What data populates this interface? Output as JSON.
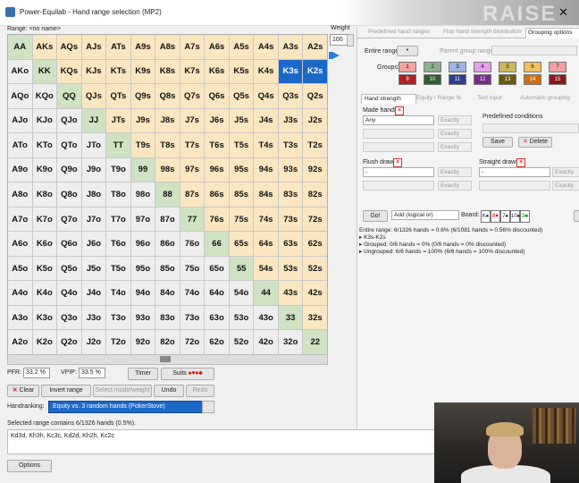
{
  "window": {
    "title": "Power-Equilab - Hand range selection (MP2)",
    "brand_bg": "RAISE"
  },
  "range": {
    "label": "Range: <no name>"
  },
  "weight": {
    "label": "Weight",
    "value": "100"
  },
  "grid": [
    [
      "AA",
      "AKs",
      "AQs",
      "AJs",
      "ATs",
      "A9s",
      "A8s",
      "A7s",
      "A6s",
      "A5s",
      "A4s",
      "A3s",
      "A2s"
    ],
    [
      "AKo",
      "KK",
      "KQs",
      "KJs",
      "KTs",
      "K9s",
      "K8s",
      "K7s",
      "K6s",
      "K5s",
      "K4s",
      "K3s",
      "K2s"
    ],
    [
      "AQo",
      "KQo",
      "QQ",
      "QJs",
      "QTs",
      "Q9s",
      "Q8s",
      "Q7s",
      "Q6s",
      "Q5s",
      "Q4s",
      "Q3s",
      "Q2s"
    ],
    [
      "AJo",
      "KJo",
      "QJo",
      "JJ",
      "JTs",
      "J9s",
      "J8s",
      "J7s",
      "J6s",
      "J5s",
      "J4s",
      "J3s",
      "J2s"
    ],
    [
      "ATo",
      "KTo",
      "QTo",
      "JTo",
      "TT",
      "T9s",
      "T8s",
      "T7s",
      "T6s",
      "T5s",
      "T4s",
      "T3s",
      "T2s"
    ],
    [
      "A9o",
      "K9o",
      "Q9o",
      "J9o",
      "T9o",
      "99",
      "98s",
      "97s",
      "96s",
      "95s",
      "94s",
      "93s",
      "92s"
    ],
    [
      "A8o",
      "K8o",
      "Q8o",
      "J8o",
      "T8o",
      "98o",
      "88",
      "87s",
      "86s",
      "85s",
      "84s",
      "83s",
      "82s"
    ],
    [
      "A7o",
      "K7o",
      "Q7o",
      "J7o",
      "T7o",
      "97o",
      "87o",
      "77",
      "76s",
      "75s",
      "74s",
      "73s",
      "72s"
    ],
    [
      "A6o",
      "K6o",
      "Q6o",
      "J6o",
      "T6o",
      "96o",
      "86o",
      "76o",
      "66",
      "65s",
      "64s",
      "63s",
      "62s"
    ],
    [
      "A5o",
      "K5o",
      "Q5o",
      "J5o",
      "T5o",
      "95o",
      "85o",
      "75o",
      "65o",
      "55",
      "54s",
      "53s",
      "52s"
    ],
    [
      "A4o",
      "K4o",
      "Q4o",
      "J4o",
      "T4o",
      "94o",
      "84o",
      "74o",
      "64o",
      "54o",
      "44",
      "43s",
      "42s"
    ],
    [
      "A3o",
      "K3o",
      "Q3o",
      "J3o",
      "T3o",
      "93o",
      "83o",
      "73o",
      "63o",
      "53o",
      "43o",
      "33",
      "32s"
    ],
    [
      "A2o",
      "K2o",
      "Q2o",
      "J2o",
      "T2o",
      "92o",
      "82o",
      "72o",
      "62o",
      "52o",
      "42o",
      "32o",
      "22"
    ]
  ],
  "selected_cells": [
    "K3s",
    "K2s"
  ],
  "stats": {
    "pfr_label": "PFR:",
    "pfr_value": "33.2 %",
    "vpip_label": "VPIP:",
    "vpip_value": "33.5 %",
    "timer_label": "Timer",
    "suits_label": "Suits",
    "suits_glyphs": "♠♥♦♣"
  },
  "actions": {
    "clear": "Clear",
    "invert": "Invert range",
    "select_mode": "Select mode/weight",
    "undo": "Undo",
    "redo": "Redo"
  },
  "handranking": {
    "label": "Handranking:",
    "value": "Equity vs. 3 random hands (PokerStove)"
  },
  "selection_info": "Selected range contains 6/1326 hands (0.5%).",
  "hands_text": "Kd3d, Kh3h, Kc3c, Kd2d, Kh2h, Kc2c",
  "options_label": "Options",
  "right_panel": {
    "tabs": [
      "Predefined hand ranges",
      "Flop hand strength distribution",
      "Grouping options"
    ],
    "entire_range_label": "Entire range:",
    "parent_group_label": "Parent group range:",
    "groups_label": "Groups:",
    "groups_row1": [
      "1",
      "2",
      "3",
      "4",
      "5",
      "6",
      "7"
    ],
    "groups_row2": [
      "9",
      "10",
      "11",
      "12",
      "13",
      "14",
      "15"
    ],
    "group_colors_row1": [
      "#f3a0a0",
      "#8fb08f",
      "#9bb5e0",
      "#e6a0e6",
      "#c9b860",
      "#f5c060",
      "#f0a0a0"
    ],
    "group_colors_row2": [
      "#b02020",
      "#2f5e2f",
      "#2c3e8c",
      "#7a2a8a",
      "#6b5a10",
      "#d07010",
      "#8a1a1a"
    ],
    "subtabs": [
      "Hand strength",
      "Equity / Range %",
      "Text input",
      "Automatic grouping"
    ],
    "made_hands_label": "Made hands",
    "made_hands_value": "Any",
    "exactly": "Exactly",
    "predefined_label": "Predefined conditions",
    "save": "Save",
    "delete": "Delete",
    "flush_label": "Flush draws",
    "straight_label": "Straight draws",
    "dash": "-",
    "go": "Go!",
    "add_logical": "Add (logical or)",
    "board_label": "Board:",
    "board_cards": [
      "K♠",
      "8♥",
      "7♠",
      "10♠",
      "3♣"
    ],
    "tree": [
      "Entire range: 6/1326 hands = 0.6%  (6/1081 hands = 0.56% discounted)",
      "▸ K3s-K2s",
      "▸ Grouped: 0/6 hands = 0%  (0/6 hands = 0% discounted)",
      "▸ Ungrouped: 6/6 hands = 100%  (6/6 hands = 100% discounted)"
    ]
  }
}
